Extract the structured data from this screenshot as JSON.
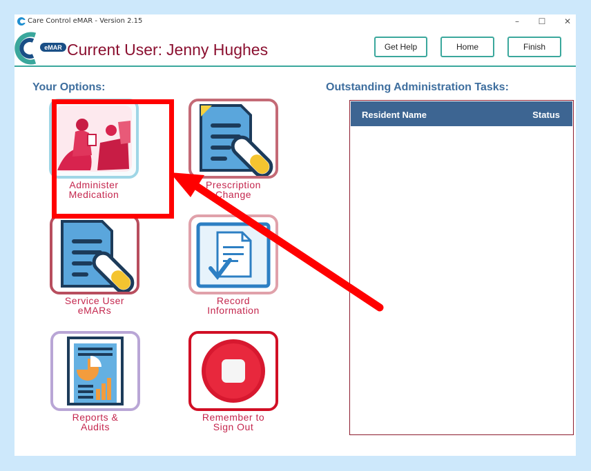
{
  "window": {
    "title": "Care Control eMAR - Version 2.15",
    "controls": [
      "–",
      "☐",
      "✕"
    ]
  },
  "header": {
    "logo_text": "eMAR",
    "current_user_label": "Current User:",
    "current_user_name": "Jenny Hughes",
    "buttons": {
      "help": "Get Help",
      "home": "Home",
      "finish": "Finish"
    }
  },
  "options": {
    "title": "Your Options:",
    "tiles": [
      {
        "line1": "Administer",
        "line2": "Medication",
        "icon": "nurse-patient-icon"
      },
      {
        "line1": "Prescription",
        "line2": "Change",
        "icon": "prescription-document-icon"
      },
      {
        "line1": "Service User",
        "line2": "eMARs",
        "icon": "emar-document-icon"
      },
      {
        "line1": "Record",
        "line2": "Information",
        "icon": "record-document-icon"
      },
      {
        "line1": "Reports &",
        "line2": "Audits",
        "icon": "reports-chart-icon"
      },
      {
        "line1": "Remember to",
        "line2": "Sign Out",
        "icon": "stop-sign-out-icon"
      }
    ]
  },
  "tasks": {
    "title": "Outstanding Administration Tasks:",
    "columns": [
      "Resident Name",
      "Status"
    ],
    "rows": []
  },
  "colors": {
    "accent_teal": "#3aa79c",
    "user_text": "#8b1030",
    "tile_label": "#c4264d",
    "table_header": "#3d6592",
    "annotation_red": "#ff0000"
  }
}
